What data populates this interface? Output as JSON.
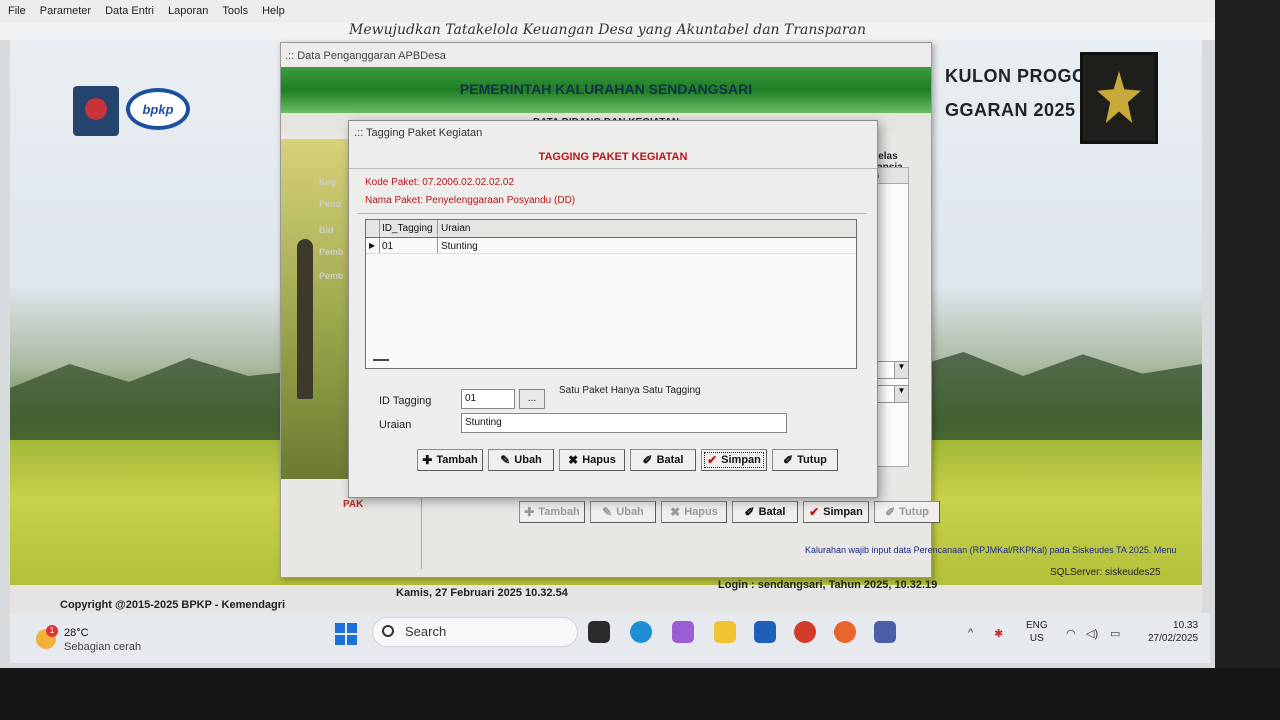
{
  "menu": [
    "File",
    "Parameter",
    "Data Entri",
    "Laporan",
    "Tools",
    "Help"
  ],
  "app_header": "Mewujudkan Tatakelola Keuangan Desa yang Akuntabel dan Transparan",
  "logos": {
    "bpkp": "bpkp"
  },
  "banner_right": {
    "region": "KULON PROGO",
    "year": "GGARAN 2025"
  },
  "apb_window": {
    "title": ".:: Data Penganggaran APBDesa",
    "banner": "PEMERINTAH KALURAHAN SENDANGSARI",
    "subbanner": "DATA BIDANG DAN KEGIATAN",
    "side_labels": [
      "Keg",
      "Pend",
      "Bid",
      "Pemb",
      "Pemb"
    ],
    "pak_label": "PAK",
    "kelas_lansia": "Kelas Lansia",
    "grid_header": "uan",
    "buttons": [
      {
        "label": "Tambah",
        "icon": "add-doc-icon",
        "enabled": false
      },
      {
        "label": "Ubah",
        "icon": "edit-doc-icon",
        "enabled": false
      },
      {
        "label": "Hapus",
        "icon": "delete-doc-icon",
        "enabled": false
      },
      {
        "label": "Batal",
        "icon": "undo-pen-icon",
        "enabled": true
      },
      {
        "label": "Simpan",
        "icon": "checkmark-icon",
        "enabled": true
      },
      {
        "label": "Tutup",
        "icon": "close-pen-icon",
        "enabled": false
      }
    ]
  },
  "dialog": {
    "title": ".:: Tagging Paket Kegiatan",
    "heading": "TAGGING PAKET KEGIATAN",
    "kode_paket": "Kode Paket: 07.2006.02.02.02.02",
    "nama_paket": "Nama Paket: Penyelenggaraan Posyandu (DD)",
    "grid": {
      "columns": [
        "ID_Tagging",
        "Uraian"
      ],
      "rows": [
        {
          "id": "01",
          "uraian": "Stunting",
          "selected": true
        }
      ]
    },
    "form": {
      "id_label": "ID Tagging",
      "id_value": "01",
      "browse_label": "...",
      "hint": "Satu Paket Hanya Satu Tagging",
      "uraian_label": "Uraian",
      "uraian_value": "Stunting"
    },
    "buttons": [
      {
        "label": "Tambah",
        "icon": "add-doc-icon"
      },
      {
        "label": "Ubah",
        "icon": "edit-doc-icon"
      },
      {
        "label": "Hapus",
        "icon": "delete-doc-icon"
      },
      {
        "label": "Batal",
        "icon": "undo-pen-icon"
      },
      {
        "label": "Simpan",
        "icon": "checkmark-icon"
      },
      {
        "label": "Tutup",
        "icon": "close-pen-icon"
      }
    ]
  },
  "statusbar": {
    "copyright": "Copyright @2015-2025 BPKP - Kemendagri",
    "datetime": "Kamis, 27 Februari 2025  10.32.54",
    "login": "Login : sendangsari,  Tahun 2025, 10.32.19",
    "sqlserver": "SQLServer: siskeudes25",
    "notice": "Kalurahan wajib input data Perencanaan (RPJMKal/RKPKal) pada Siskeudes TA 2025. Menu"
  },
  "taskbar": {
    "weather_badge": "1",
    "temperature": "28°C",
    "condition": "Sebagian cerah",
    "search_placeholder": "Search",
    "lang_top": "ENG",
    "lang_bottom": "US",
    "time": "10.33",
    "date": "27/02/2025"
  },
  "colors": {
    "accent_red": "#b4171b",
    "banner_green": "#1f7e25",
    "windows_blue": "#1d6fd9"
  }
}
